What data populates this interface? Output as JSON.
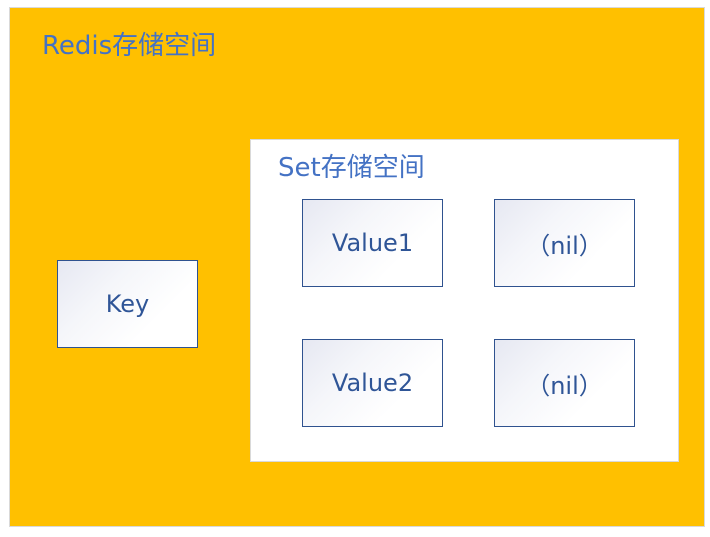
{
  "redis_space": {
    "title": "Redis存储空间",
    "fill_color": "#FFC000",
    "title_color": "#4472C4"
  },
  "key_box": {
    "label": "Key"
  },
  "set_space": {
    "title": "Set存储空间",
    "fill_color": "#FFFFFF",
    "title_color": "#4472C4",
    "cells": [
      {
        "label": "Value1"
      },
      {
        "label": "（nil）"
      },
      {
        "label": "Value2"
      },
      {
        "label": "（nil）"
      }
    ]
  },
  "node_border_color": "#2F528F",
  "node_text_color": "#2F5597"
}
